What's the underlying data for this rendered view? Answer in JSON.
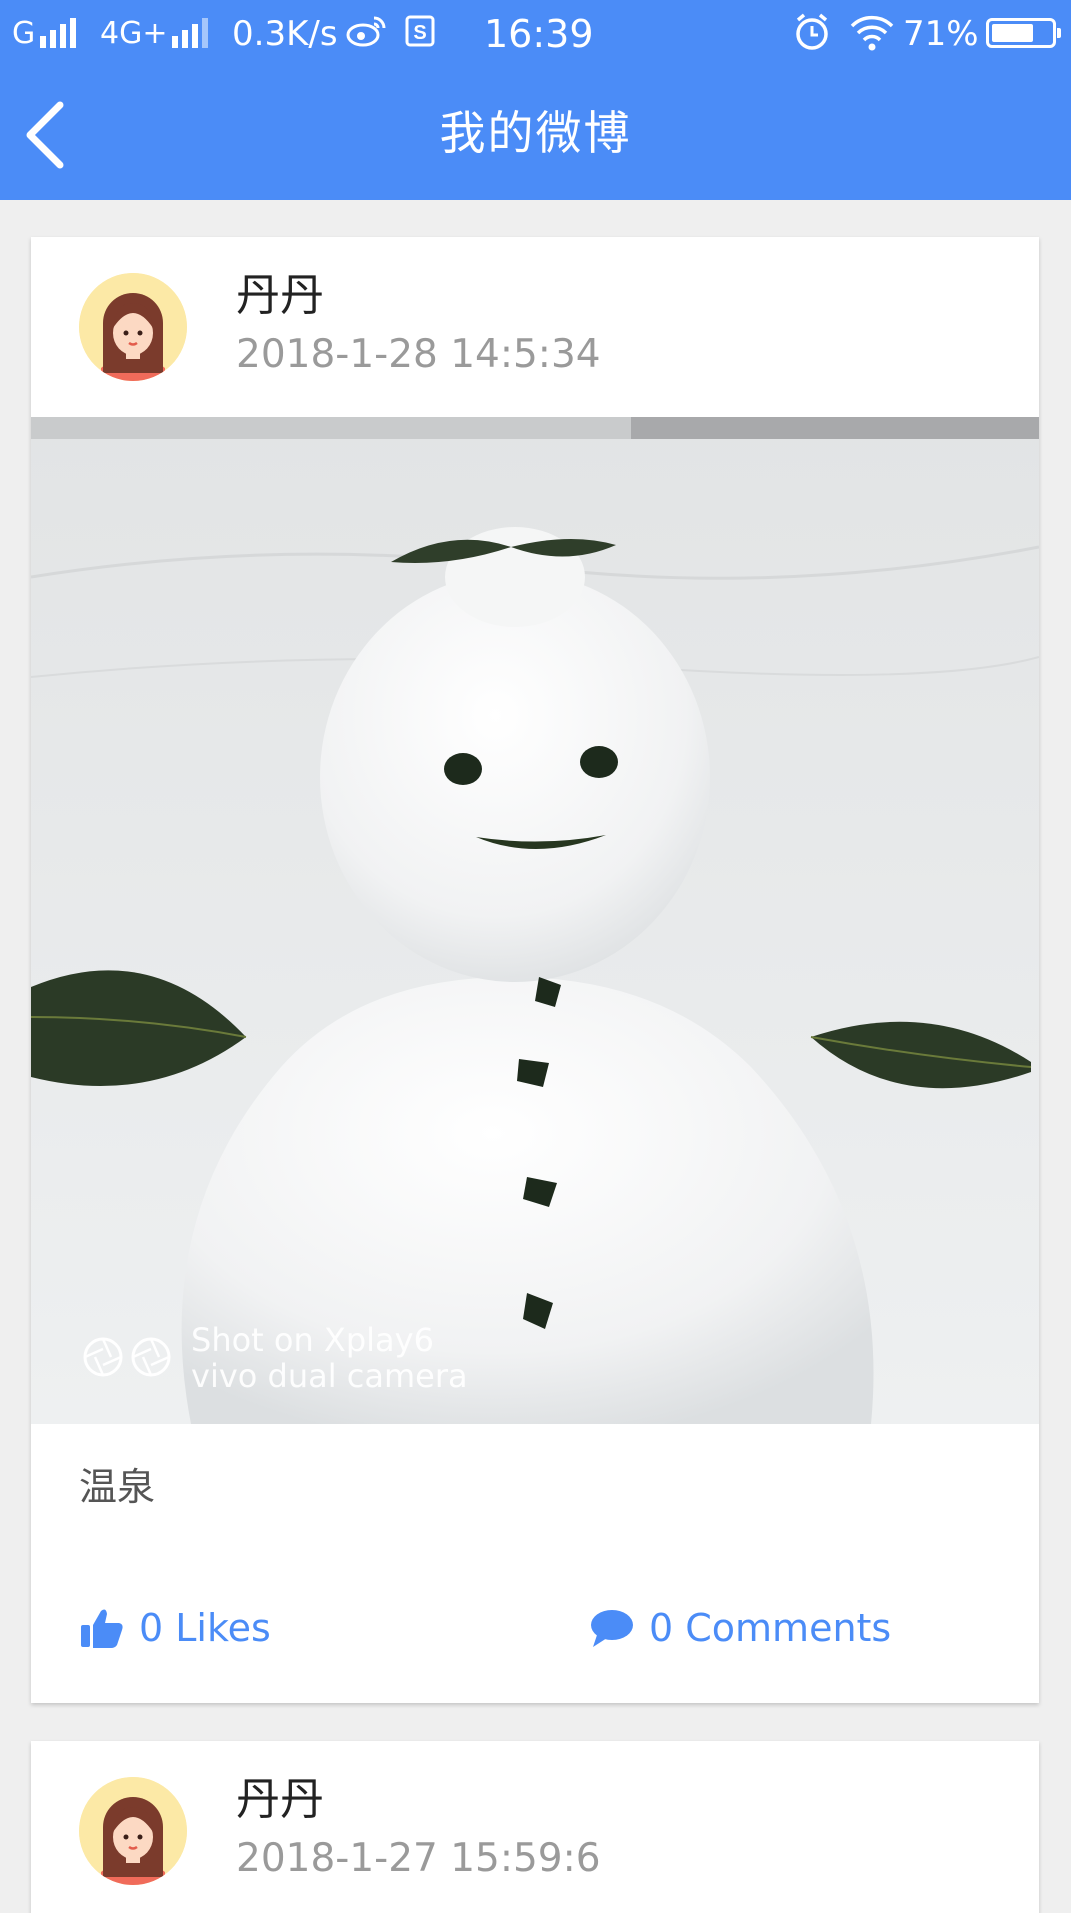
{
  "status_bar": {
    "network_left": "G",
    "network_right": "4G+",
    "speed": "0.3K/s",
    "time": "16:39",
    "battery_percent": "71%",
    "battery_level": 0.71,
    "icons": [
      "signal-icon",
      "weibo-icon",
      "s-app-icon",
      "alarm-icon",
      "wifi-icon",
      "battery-icon"
    ]
  },
  "app_bar": {
    "title": "我的微博",
    "back_icon": "chevron-left-icon"
  },
  "colors": {
    "accent": "#4b8cf7",
    "background": "#efefef",
    "avatar_bg": "#fce9a6"
  },
  "posts": [
    {
      "author": "丹丹",
      "time": "2018-1-28 14:5:34",
      "text": "温泉",
      "photo_watermark": [
        "Shot on Xplay6",
        "vivo dual camera"
      ],
      "likes_label": "0 Likes",
      "comments_label": "0 Comments"
    },
    {
      "author": "丹丹",
      "time": "2018-1-27 15:59:6"
    }
  ]
}
